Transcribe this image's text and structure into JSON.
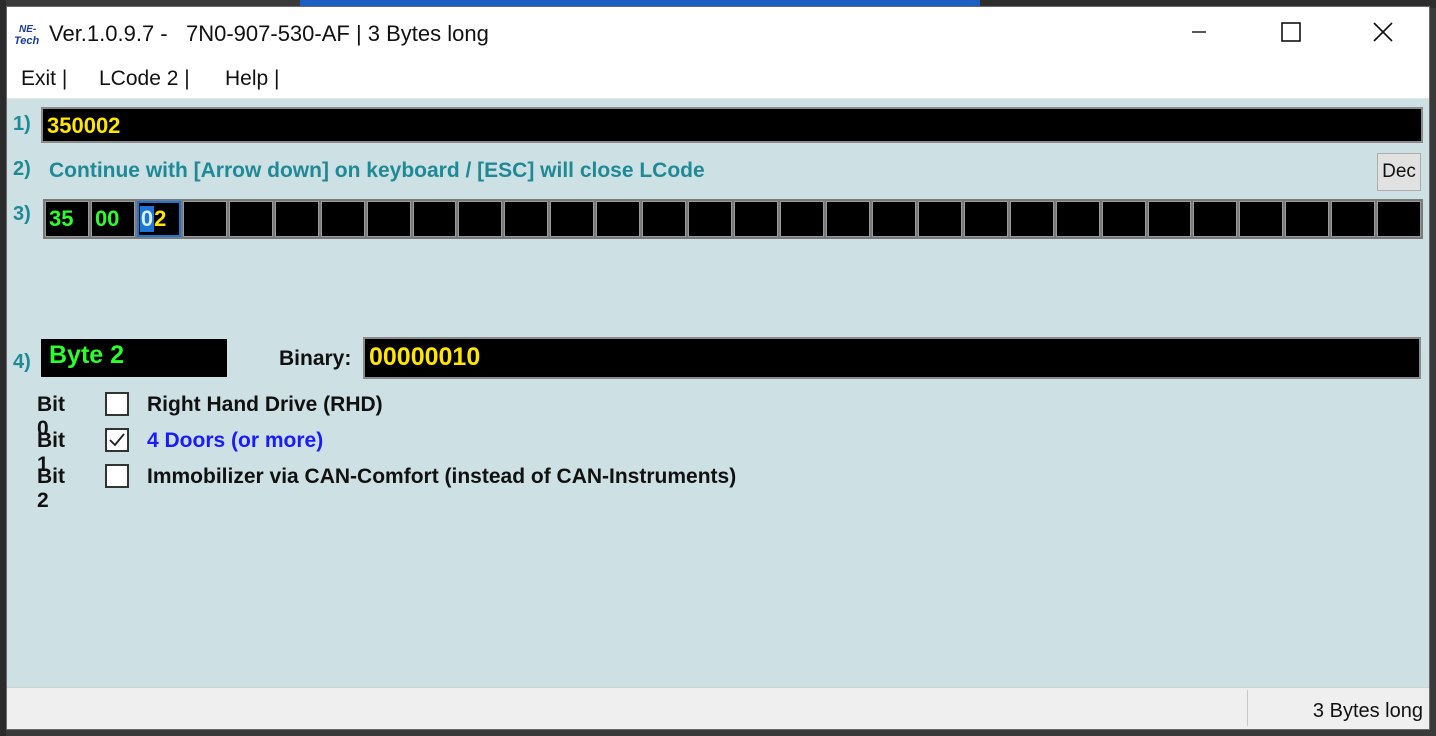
{
  "window": {
    "title": "Ver.1.0.9.7 -   7N0-907-530-AF | 3 Bytes long",
    "logo_text_top": "NE-",
    "logo_text_bottom": "Tech"
  },
  "menu": [
    {
      "label": "Exit |"
    },
    {
      "label": "LCode 2 |"
    },
    {
      "label": "Help |"
    }
  ],
  "row_labels": {
    "r1": "1)",
    "r2": "2)",
    "r3": "3)",
    "r4": "4)"
  },
  "code_value": "350002",
  "hint": "Continue with [Arrow down] on keyboard / [ESC] will close LCode",
  "dec_button": "Dec",
  "bytes": [
    {
      "value": "35"
    },
    {
      "value": "00"
    },
    {
      "selected_part": "0",
      "rest_part": "2"
    },
    {
      "value": ""
    },
    {
      "value": ""
    },
    {
      "value": ""
    },
    {
      "value": ""
    },
    {
      "value": ""
    },
    {
      "value": ""
    },
    {
      "value": ""
    },
    {
      "value": ""
    },
    {
      "value": ""
    },
    {
      "value": ""
    },
    {
      "value": ""
    },
    {
      "value": ""
    },
    {
      "value": ""
    },
    {
      "value": ""
    },
    {
      "value": ""
    },
    {
      "value": ""
    },
    {
      "value": ""
    },
    {
      "value": ""
    },
    {
      "value": ""
    },
    {
      "value": ""
    },
    {
      "value": ""
    },
    {
      "value": ""
    },
    {
      "value": ""
    },
    {
      "value": ""
    },
    {
      "value": ""
    },
    {
      "value": ""
    },
    {
      "value": ""
    }
  ],
  "byte_label": "Byte 2",
  "binary_label": "Binary:",
  "binary_value": "00000010",
  "bits": [
    {
      "name": "Bit 0",
      "checked": false,
      "desc": "Right Hand Drive (RHD)"
    },
    {
      "name": "Bit 1",
      "checked": true,
      "desc": "4 Doors (or more)"
    },
    {
      "name": "Bit 2",
      "checked": false,
      "desc": "Immobilizer via CAN-Comfort (instead of CAN-Instruments)"
    }
  ],
  "status": "3 Bytes long",
  "colors": {
    "accent_teal": "#1f8a96",
    "panel_bg": "#cde0e3",
    "highlight_green": "#2bff2b",
    "highlight_yellow": "#ffe600",
    "checked_blue": "#1a1aff"
  }
}
